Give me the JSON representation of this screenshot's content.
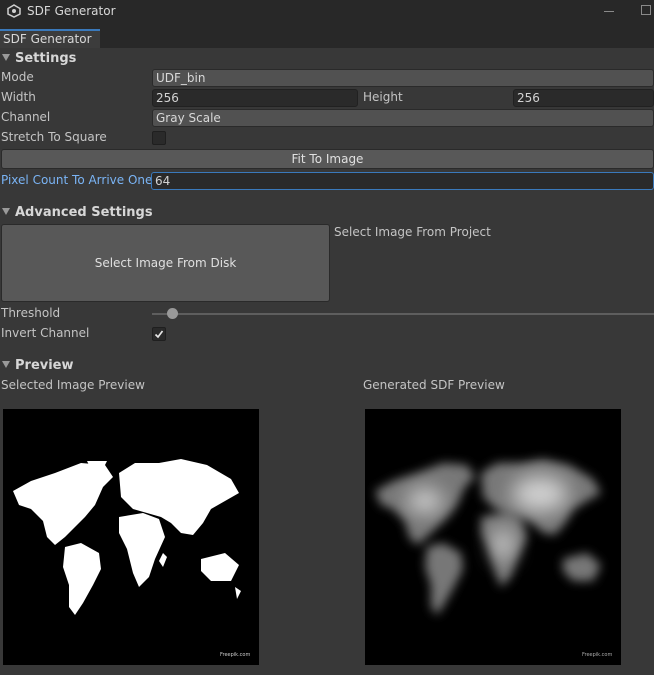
{
  "window": {
    "title": "SDF Generator",
    "tab": "SDF Generator"
  },
  "settings": {
    "header": "Settings",
    "mode_label": "Mode",
    "mode_value": "UDF_bin",
    "width_label": "Width",
    "width_value": "256",
    "height_label": "Height",
    "height_value": "256",
    "channel_label": "Channel",
    "channel_value": "Gray Scale",
    "stretch_label": "Stretch To Square",
    "stretch_checked": false,
    "fit_button": "Fit To Image",
    "pixel_count_label": "Pixel Count To Arrive One",
    "pixel_count_value": "64"
  },
  "advanced": {
    "header": "Advanced Settings",
    "select_disk_button": "Select Image From Disk",
    "select_project_label": "Select Image From Project",
    "threshold_label": "Threshold",
    "threshold_fraction": 0.02,
    "invert_label": "Invert Channel",
    "invert_checked": true
  },
  "preview": {
    "header": "Preview",
    "selected_label": "Selected Image Preview",
    "generated_label": "Generated SDF Preview",
    "watermark": "Freepik.com"
  },
  "colors": {
    "accent": "#3a79bb",
    "background": "#383838",
    "field": "#2a2a2a"
  },
  "icons": {
    "app": "unity-icon",
    "foldout": "triangle-down-icon",
    "check": "check-icon"
  }
}
